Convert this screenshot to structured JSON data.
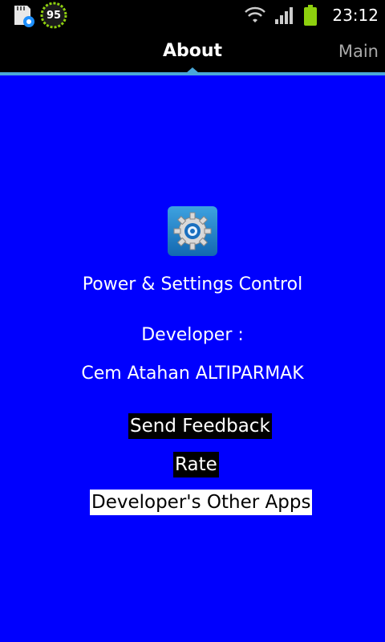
{
  "status_bar": {
    "time": "23:12",
    "battery_badge": "95",
    "icons": [
      "sdcard-settings-icon",
      "battery-percent-badge",
      "wifi-icon",
      "signal-icon",
      "battery-icon"
    ]
  },
  "tabs": {
    "active": "About",
    "next": "Main"
  },
  "about": {
    "app_name": "Power & Settings Control",
    "developer_label": "Developer :",
    "developer_name": "Cem Atahan ALTIPARMAK"
  },
  "buttons": {
    "feedback": "Send Feedback",
    "rate": "Rate",
    "other_apps": "Developer's Other Apps"
  },
  "colors": {
    "background": "#0000fe",
    "tab_indicator": "#4aa8d8",
    "battery_green": "#8ed00e"
  }
}
